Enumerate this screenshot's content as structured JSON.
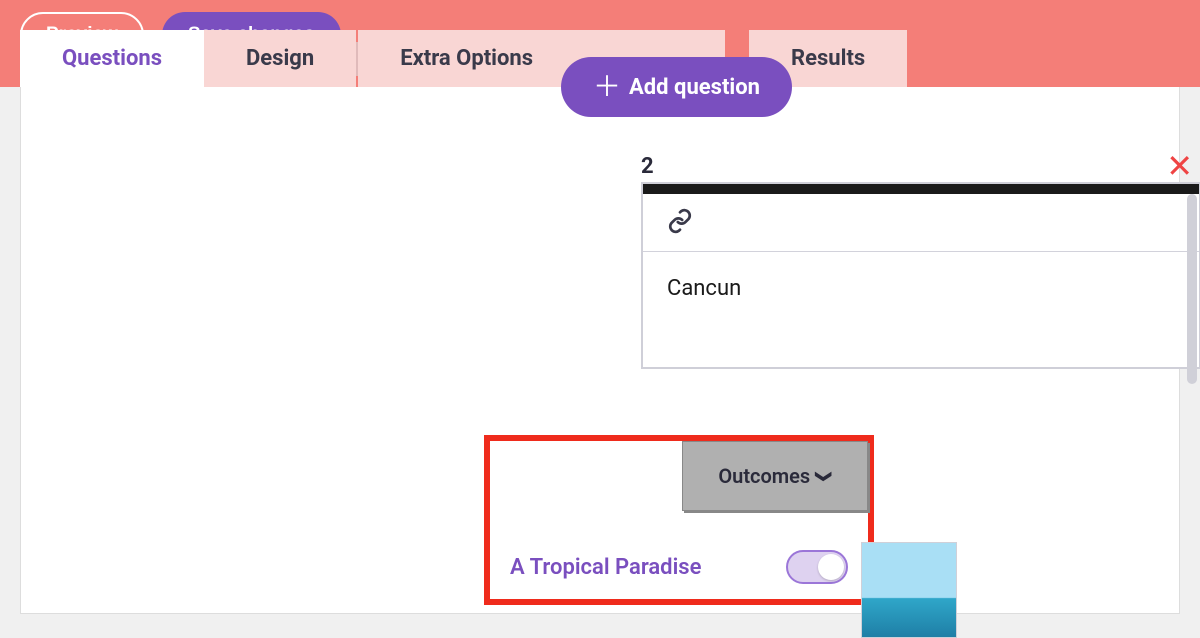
{
  "toolbar": {
    "preview": "Preview",
    "save": "Save changes"
  },
  "tabs": {
    "questions": "Questions",
    "design": "Design",
    "extra": "Extra Options",
    "results": "Results"
  },
  "add_question": "Add question",
  "question": {
    "number": "2",
    "text": "Cancun"
  },
  "outcomes": {
    "button": "Outcomes",
    "items": [
      {
        "label": "A Tropical Paradise",
        "enabled": true
      }
    ]
  }
}
